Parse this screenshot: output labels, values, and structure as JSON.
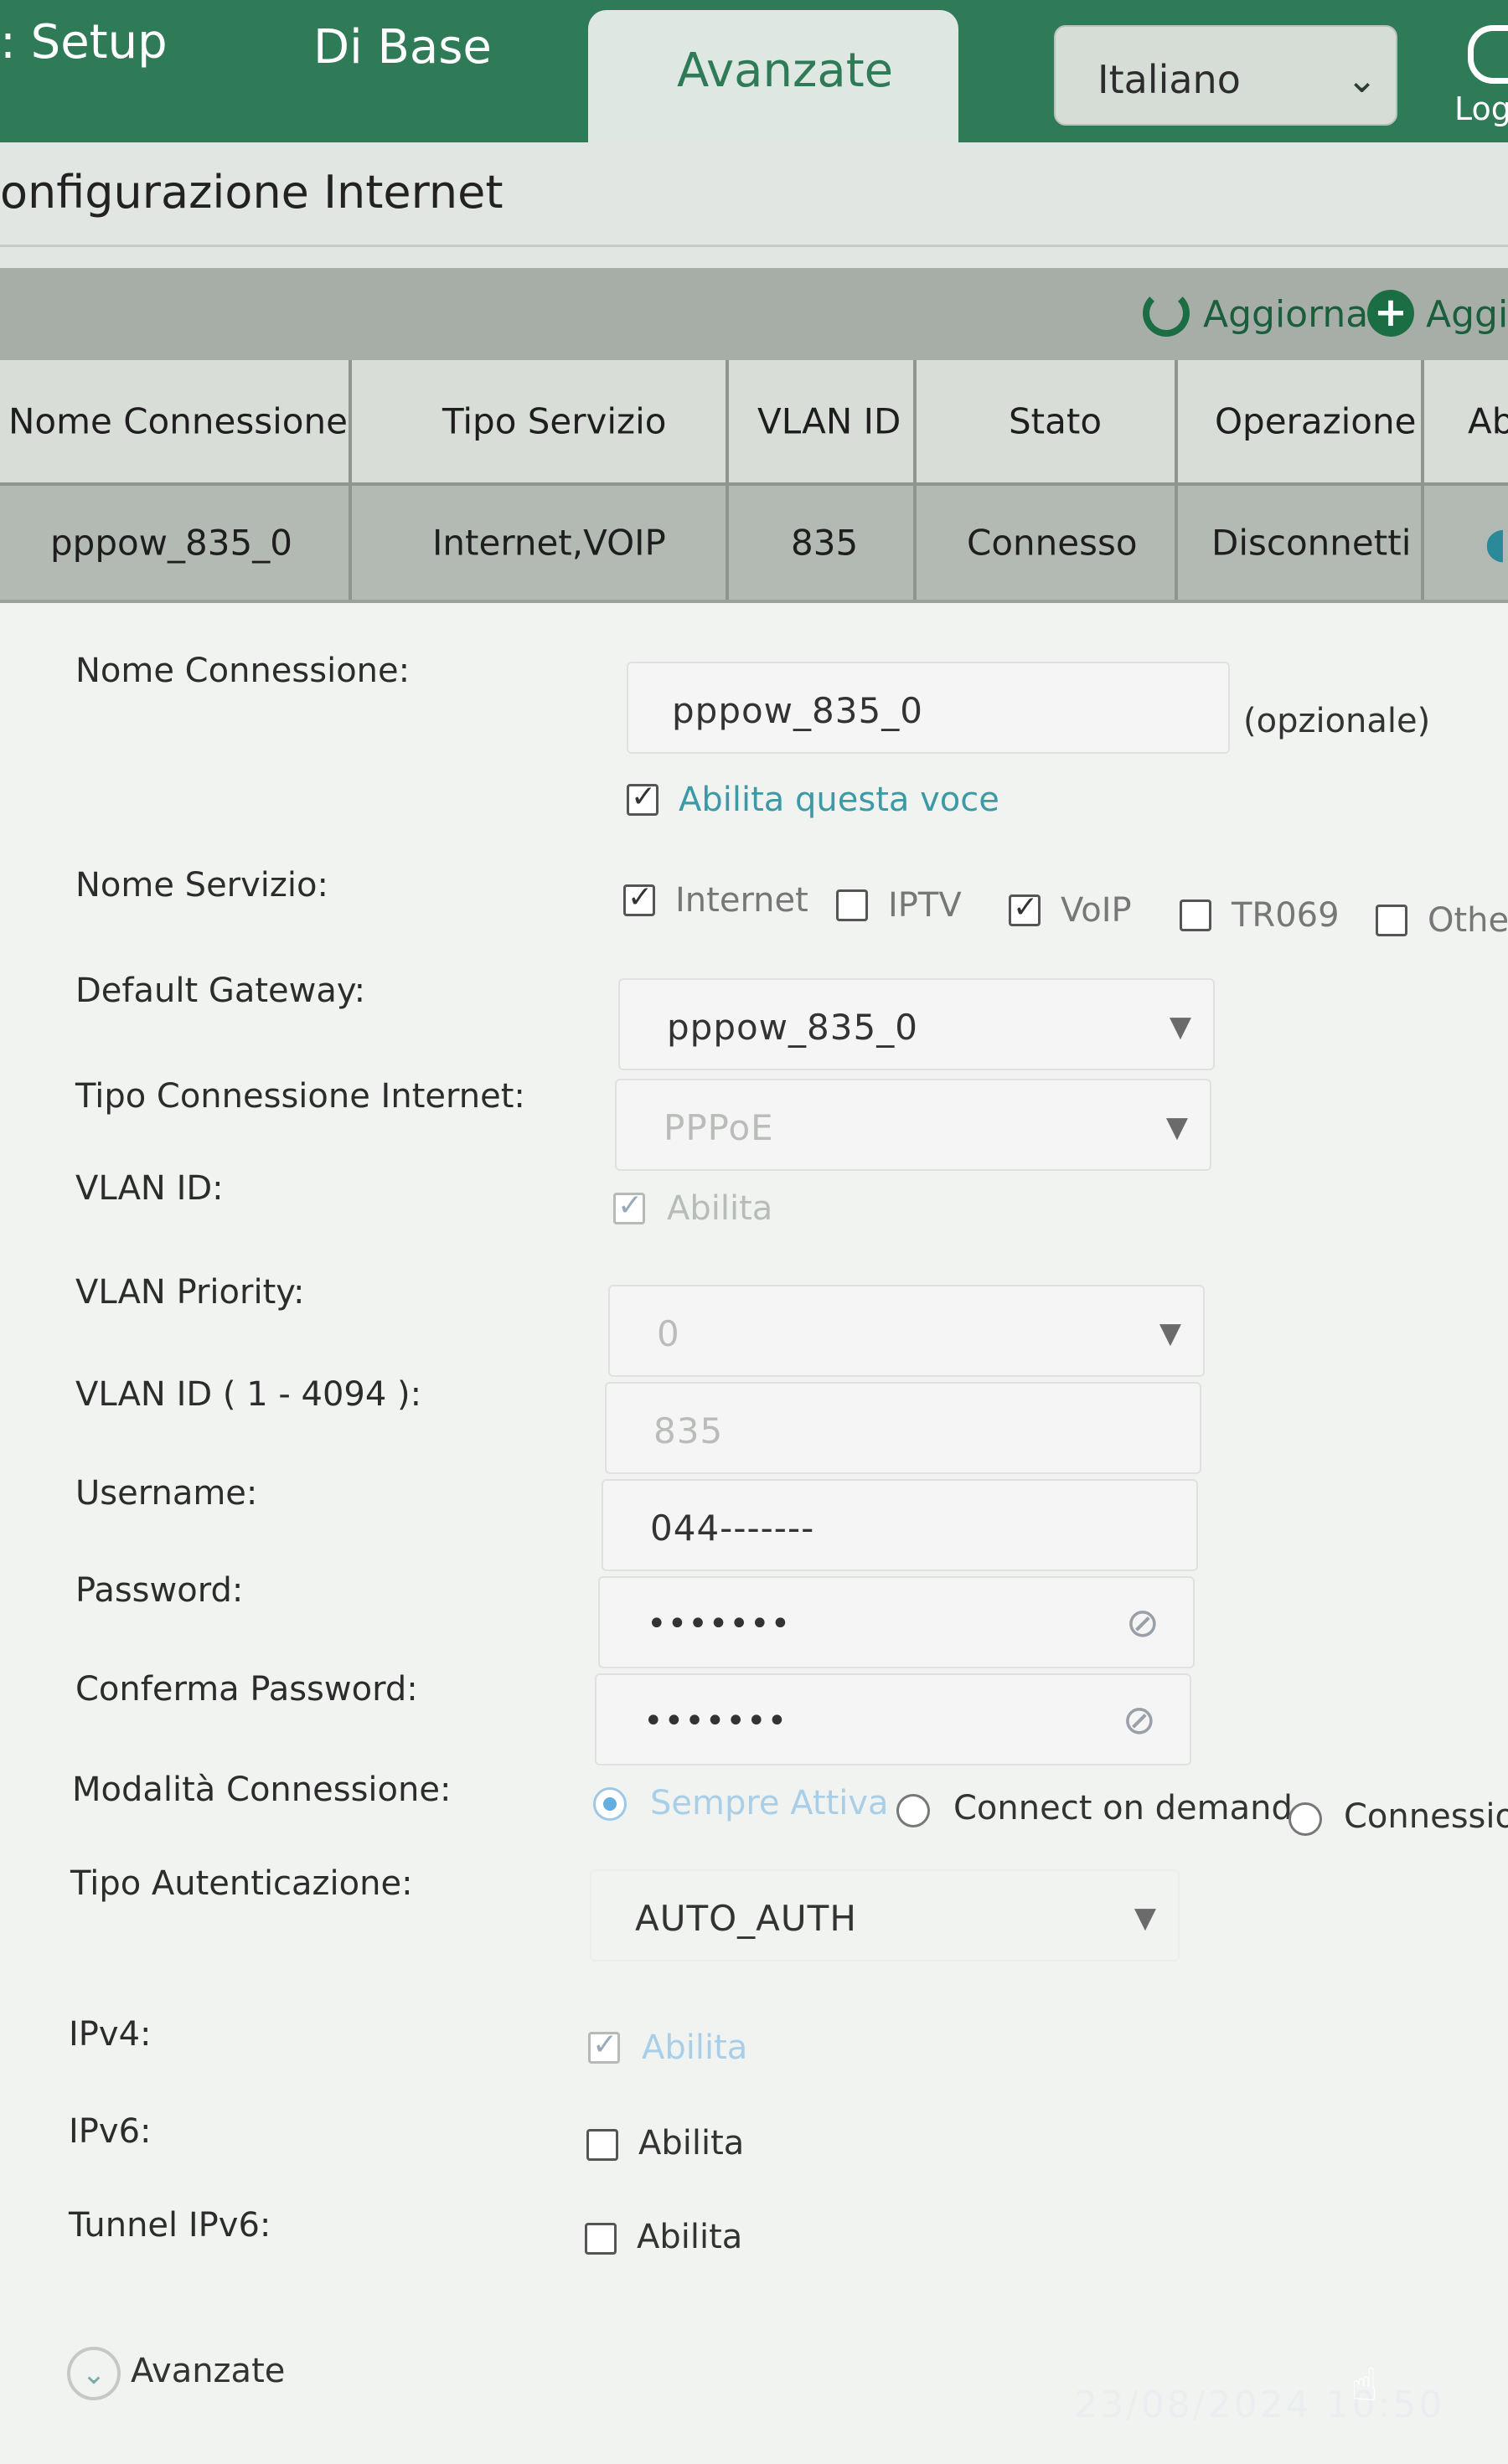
{
  "nav": {
    "tabs": [
      {
        "label": ": Setup"
      },
      {
        "label": "Di Base"
      },
      {
        "label": "Avanzate"
      }
    ],
    "language": "Italiano",
    "logout_label": "Log"
  },
  "page_title": "onfigurazione Internet",
  "toolbar": {
    "refresh_label": "Aggiorna",
    "add_label": "Aggiu"
  },
  "table": {
    "headers": [
      "Nome Connessione",
      "Tipo Servizio",
      "VLAN ID",
      "Stato",
      "Operazione",
      "Ab"
    ],
    "rows": [
      {
        "name": "pppow_835_0",
        "service": "Internet,VOIP",
        "vlan": "835",
        "status": "Connesso",
        "operation": "Disconnetti"
      }
    ]
  },
  "form": {
    "connection_name": {
      "label": "Nome Connessione:",
      "value": "pppow_835_0",
      "note": "(opzionale)"
    },
    "enable_entry": {
      "label": "Abilita questa voce",
      "checked": true
    },
    "service_name": {
      "label": "Nome Servizio:",
      "options": [
        {
          "label": "Internet",
          "checked": true
        },
        {
          "label": "IPTV",
          "checked": false
        },
        {
          "label": "VoIP",
          "checked": true
        },
        {
          "label": "TR069",
          "checked": false
        },
        {
          "label": "Other",
          "checked": false
        }
      ]
    },
    "default_gateway": {
      "label": "Default Gateway:",
      "value": "pppow_835_0"
    },
    "connection_type": {
      "label": "Tipo Connessione Internet:",
      "value": "PPPoE"
    },
    "vlan_id_enable": {
      "label": "VLAN ID:",
      "option": "Abilita",
      "checked": true
    },
    "vlan_priority": {
      "label": "VLAN Priority:",
      "value": "0"
    },
    "vlan_id_value": {
      "label": "VLAN ID ( 1 - 4094 ):",
      "value": "835"
    },
    "username": {
      "label": "Username:",
      "value": "044-------"
    },
    "password": {
      "label": "Password:",
      "value": "•••••••"
    },
    "confirm_password": {
      "label": "Conferma Password:",
      "value": "•••••••"
    },
    "connection_mode": {
      "label": "Modalità Connessione:",
      "options": [
        {
          "label": "Sempre Attiva",
          "selected": true
        },
        {
          "label": "Connect on demand",
          "selected": false
        },
        {
          "label": "Connession",
          "selected": false
        }
      ]
    },
    "auth_type": {
      "label": "Tipo Autenticazione:",
      "value": "AUTO_AUTH"
    },
    "ipv4": {
      "label": "IPv4:",
      "option": "Abilita",
      "checked": true
    },
    "ipv6": {
      "label": "IPv6:",
      "option": "Abilita",
      "checked": false
    },
    "tunnel_ipv6": {
      "label": "Tunnel IPv6:",
      "option": "Abilita",
      "checked": false
    },
    "advanced_label": "Avanzate"
  },
  "timestamp": "23/08/2024 10:50",
  "colors": {
    "brand": "#2f7a57",
    "accent": "#3c9aa6"
  }
}
